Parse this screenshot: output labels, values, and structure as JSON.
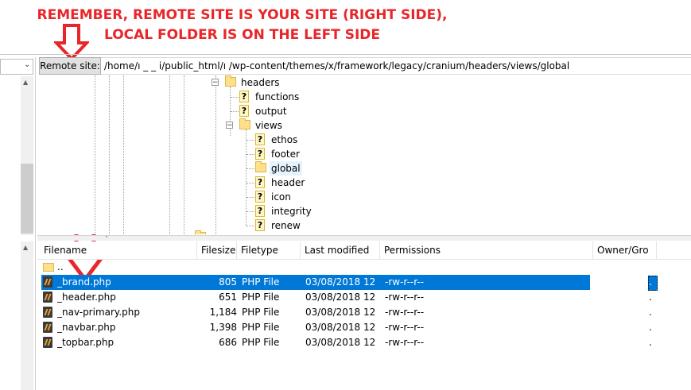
{
  "annotation": {
    "line1": "REMEMBER, REMOTE SITE IS YOUR SITE (RIGHT SIDE),",
    "line2": "LOCAL FOLDER IS ON THE LEFT SIDE",
    "color": "#e8262a"
  },
  "remote_site": {
    "label": "Remote site:",
    "path": "/home/ı    _ _ i/public_html/ı    /wp-content/themes/x/framework/legacy/cranium/headers/views/global"
  },
  "tree": {
    "headers": "headers",
    "functions": "functions",
    "output": "output",
    "views": "views",
    "ethos": "ethos",
    "footer": "footer",
    "global": "global",
    "header": "header",
    "icon": "icon",
    "integrity": "integrity",
    "renew": "renew",
    "collapse_glyph": "−",
    "unknown_glyph": "?"
  },
  "columns": {
    "filename": "Filename",
    "filesize": "Filesize",
    "filetype": "Filetype",
    "last_modified": "Last modified",
    "permissions": "Permissions",
    "owner": "Owner/Gro"
  },
  "parent_dir": "..",
  "files": [
    {
      "name": "_brand.php",
      "size": "805",
      "type": "PHP File",
      "modified": "03/08/2018 12:...",
      "perms": "-rw-r--r--",
      "owner": ".",
      "selected": true
    },
    {
      "name": "_header.php",
      "size": "651",
      "type": "PHP File",
      "modified": "03/08/2018 12:...",
      "perms": "-rw-r--r--",
      "owner": "."
    },
    {
      "name": "_nav-primary.php",
      "size": "1,184",
      "type": "PHP File",
      "modified": "03/08/2018 12:...",
      "perms": "-rw-r--r--",
      "owner": "."
    },
    {
      "name": "_navbar.php",
      "size": "1,398",
      "type": "PHP File",
      "modified": "03/08/2018 12:...",
      "perms": "-rw-r--r--",
      "owner": "."
    },
    {
      "name": "_topbar.php",
      "size": "686",
      "type": "PHP File",
      "modified": "03/08/2018 12:...",
      "perms": "-rw-r--r--",
      "owner": "."
    }
  ],
  "colors": {
    "selection": "#0078d7",
    "arrow": "#e8262a"
  }
}
